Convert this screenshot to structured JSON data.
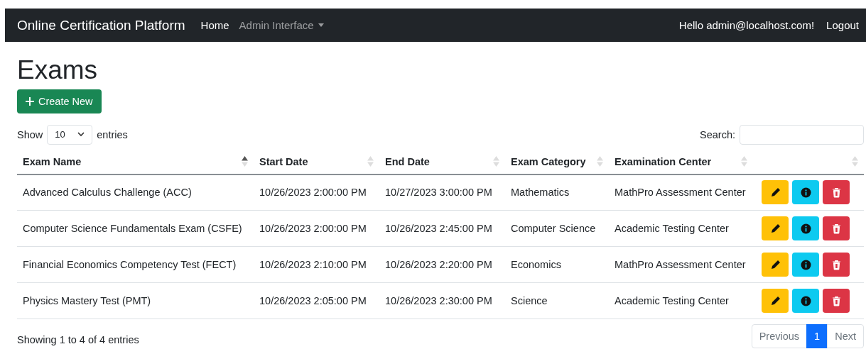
{
  "navbar": {
    "brand": "Online Certification Platform",
    "links": [
      {
        "label": "Home",
        "kind": "link",
        "active": true
      },
      {
        "label": "Admin Interface",
        "kind": "dropdown",
        "active": false
      }
    ],
    "greeting": "Hello admin@localhost.com!",
    "logout": "Logout"
  },
  "page_title": "Exams",
  "create_button": "Create New",
  "length_control": {
    "before": "Show",
    "value": "10",
    "after": "entries"
  },
  "search": {
    "label": "Search:"
  },
  "table": {
    "columns": [
      {
        "label": "Exam Name",
        "sorted": true
      },
      {
        "label": "Start Date",
        "sorted": false
      },
      {
        "label": "End Date",
        "sorted": false
      },
      {
        "label": "Exam Category",
        "sorted": false
      },
      {
        "label": "Examination Center",
        "sorted": false
      },
      {
        "sorted": false
      }
    ],
    "rows": [
      {
        "cells": [
          "Advanced Calculus Challenge (ACC)",
          "10/26/2023 2:00:00 PM",
          "10/27/2023 3:00:00 PM",
          "Mathematics",
          "MathPro Assessment Center"
        ]
      },
      {
        "cells": [
          "Computer Science Fundamentals Exam (CSFE)",
          "10/26/2023 2:00:00 PM",
          "10/26/2023 2:45:00 PM",
          "Computer Science",
          "Academic Testing Center"
        ]
      },
      {
        "cells": [
          "Financial Economics Competency Test (FECT)",
          "10/26/2023 2:10:00 PM",
          "10/26/2023 2:20:00 PM",
          "Economics",
          "MathPro Assessment Center"
        ]
      },
      {
        "cells": [
          "Physics Mastery Test (PMT)",
          "10/26/2023 2:05:00 PM",
          "10/26/2023 2:30:00 PM",
          "Science",
          "Academic Testing Center"
        ]
      }
    ]
  },
  "info": "Showing 1 to 4 of 4 entries",
  "pagination": [
    {
      "label": "Previous",
      "selected": false,
      "disabled": true
    },
    {
      "label": "1",
      "selected": true,
      "disabled": false
    },
    {
      "label": "Next",
      "selected": false,
      "disabled": true
    }
  ]
}
